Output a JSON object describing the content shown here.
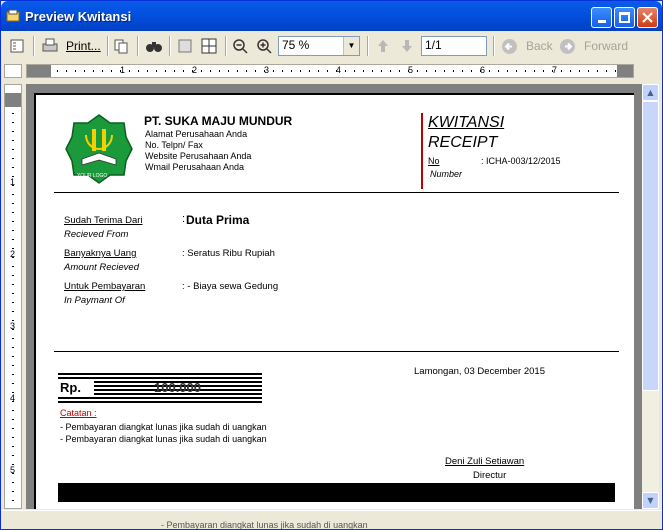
{
  "window": {
    "title": "Preview Kwitansi"
  },
  "toolbar": {
    "print_label": "Print...",
    "zoom_value": "75 %",
    "page_value": "1/1",
    "back_label": "Back",
    "forward_label": "Forward"
  },
  "ruler": {
    "h_numbers": [
      "1",
      "2",
      "3",
      "4",
      "5",
      "6",
      "7"
    ],
    "v_numbers": [
      "1",
      "2",
      "3",
      "4",
      "5"
    ]
  },
  "receipt": {
    "logo_text": "YOUR LOGO",
    "company_name": "PT. SUKA MAJU MUNDUR",
    "company_lines": [
      "Alamat Perusahaan Anda",
      "No. Telpn/ Fax",
      "Website Perusahaan Anda",
      "Wmail Perusahaan Anda"
    ],
    "title1": "KWITANSI",
    "title2": "RECEIPT",
    "no_label": "No",
    "no_value": ": ICHA-003/12/2015",
    "number_label": "Number",
    "received_from_label": "Sudah Terima Dari",
    "received_from_label_en": "Recieved From",
    "received_from_value": "Duta Prima",
    "received_from_colon": ":",
    "amount_label": "Banyaknya Uang",
    "amount_label_en": "Amount Recieved",
    "amount_value": ": Seratus Ribu Rupiah",
    "purpose_label": "Untuk Pembayaran",
    "purpose_label_en": "In Paymant Of",
    "purpose_value": ": - Biaya sewa Gedung",
    "place_date": "Lamongan, 03 December 2015",
    "rp_label": "Rp.",
    "rp_value": "100.000",
    "notes_label": "Catatan :",
    "notes": [
      "- Pembayaran diangkat lunas jika sudah di uangkan",
      "- Pembayaran diangkat lunas jika sudah di uangkan"
    ],
    "signer_name": "Deni Zuli Setiawan",
    "signer_title": "Directur"
  },
  "status": {
    "text": "- Pembayaran diangkat lunas jika sudah di uangkan"
  },
  "colors": {
    "accent_red": "#c00000",
    "logo_green": "#1a9a3a",
    "title_blue": "#0454e4"
  }
}
